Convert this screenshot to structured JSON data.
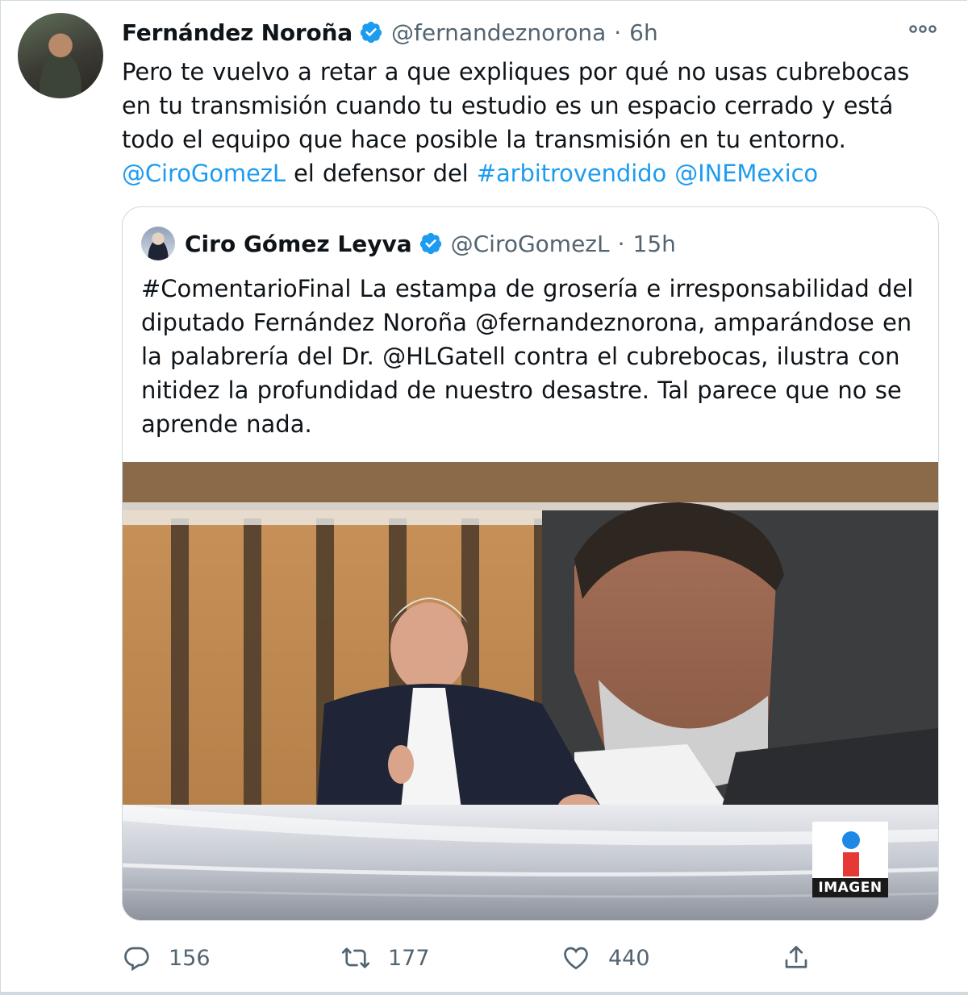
{
  "tweet": {
    "author_name": "Fernández Noroña",
    "author_handle": "@fernandeznorona",
    "separator": "·",
    "time": "6h",
    "text_parts": [
      "Pero te vuelvo a retar a que expliques por qué no usas cubrebocas en tu transmisión cuando tu estudio es un espacio cerrado y está todo el equipo que hace posible la transmisión en tu entorno. ",
      "@CiroGomezL",
      " el defensor del ",
      "#arbitrovendido",
      " ",
      "@INEMexico"
    ],
    "icons": {
      "avatar": "profile-photo",
      "verified": "verified-badge-icon",
      "more": "more-options-icon"
    }
  },
  "quoted": {
    "author_name": "Ciro Gómez Leyva",
    "author_handle": "@CiroGomezL",
    "separator": "·",
    "time": "15h",
    "text": "#ComentarioFinal La estampa de grosería e irresponsabilidad del diputado Fernández Noroña @fernandeznorona, amparándose en la palabrería del Dr. @HLGatell contra el cubrebocas, ilustra con nitidez la profundidad de nuestro desastre. Tal parece que no se aprende nada.",
    "media": {
      "kind": "video-still",
      "logo_text": "IMAGEN"
    }
  },
  "actions": {
    "reply_count": "156",
    "retweet_count": "177",
    "like_count": "440"
  },
  "colors": {
    "link": "#1d9bf0",
    "secondary_text": "#536471",
    "primary_text": "#0f1419",
    "border": "#cfd9de"
  }
}
